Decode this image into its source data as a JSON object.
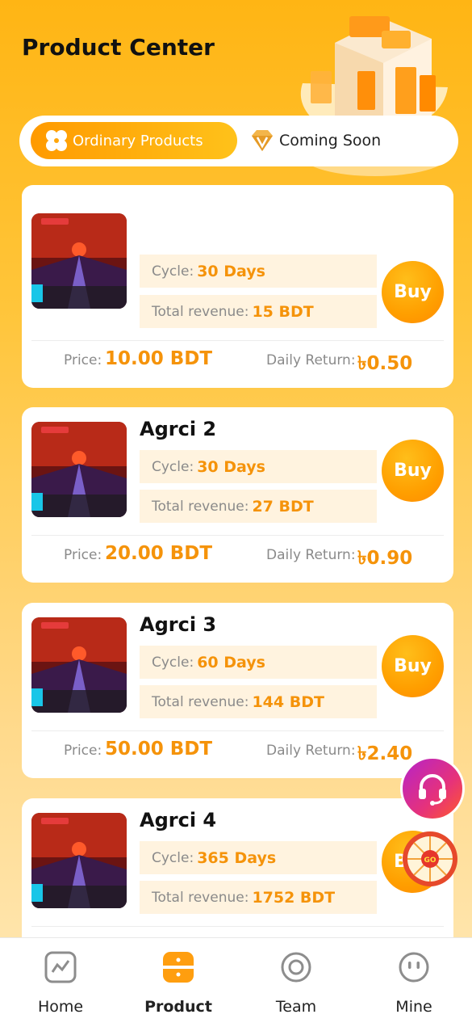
{
  "header": {
    "title": "Product Center"
  },
  "tabs": [
    {
      "label": "Ordinary Products",
      "active": true,
      "icon": "clover-icon"
    },
    {
      "label": "Coming Soon",
      "active": false,
      "icon": "diamond-icon"
    }
  ],
  "labels": {
    "cycle": "Cycle:",
    "total_revenue": "Total revenue:",
    "price": "Price:",
    "daily_return": "Daily Return:",
    "buy": "Buy"
  },
  "products": [
    {
      "name": "",
      "cycle": "30 Days",
      "total_revenue": "15 BDT",
      "price": "10.00 BDT",
      "daily_return": "৳0.50"
    },
    {
      "name": "Agrci 2",
      "cycle": "30 Days",
      "total_revenue": "27 BDT",
      "price": "20.00 BDT",
      "daily_return": "৳0.90"
    },
    {
      "name": "Agrci 3",
      "cycle": "60 Days",
      "total_revenue": "144 BDT",
      "price": "50.00 BDT",
      "daily_return": "৳2.40"
    },
    {
      "name": "Agrci 4",
      "cycle": "365 Days",
      "total_revenue": "1752 BDT",
      "price": "",
      "daily_return": ""
    }
  ],
  "floating": {
    "support_icon": "headset-icon",
    "wheel_icon": "lucky-wheel-icon",
    "wheel_label": "GO"
  },
  "tabbar": [
    {
      "label": "Home",
      "icon": "chart-icon",
      "active": false
    },
    {
      "label": "Product",
      "icon": "product-icon",
      "active": true
    },
    {
      "label": "Team",
      "icon": "target-icon",
      "active": false
    },
    {
      "label": "Mine",
      "icon": "face-icon",
      "active": false
    }
  ],
  "colors": {
    "accent": "#f5930a",
    "background_top": "#ffb514",
    "info_box": "#fff3df"
  }
}
